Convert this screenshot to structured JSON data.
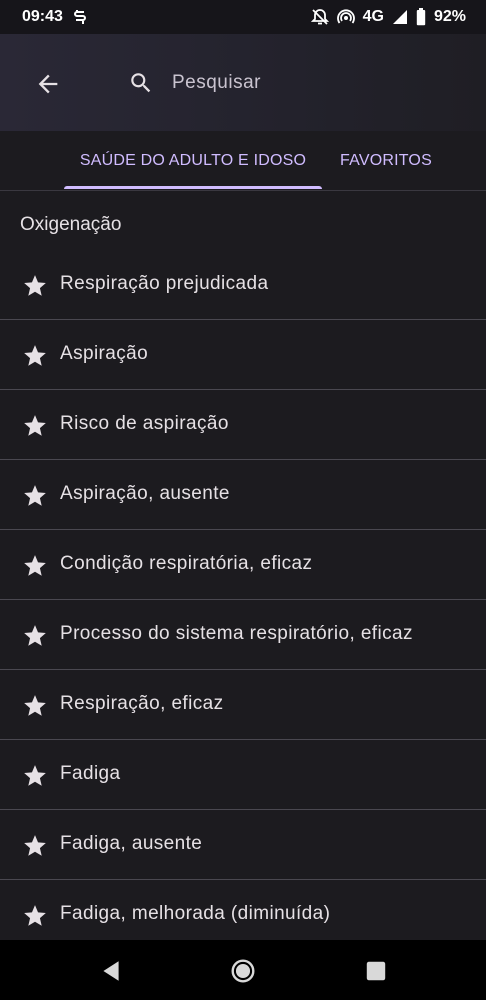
{
  "status_bar": {
    "time": "09:43",
    "network": "4G",
    "battery": "92%",
    "icons": [
      "s-app-icon",
      "bell-off-icon",
      "hotspot-icon",
      "signal-icon",
      "battery-icon"
    ]
  },
  "app_bar": {
    "back_icon": "arrow-left-icon",
    "search_icon": "search-icon",
    "search_placeholder": "Pesquisar"
  },
  "tabs": [
    {
      "label": "SAÚDE DO ADULTO E IDOSO",
      "selected": true
    },
    {
      "label": "FAVORITOS",
      "selected": false
    }
  ],
  "colors": {
    "accent": "#d0bcff",
    "background": "#1c1b1f",
    "text": "#e6e1e5"
  },
  "section": {
    "title": "Oxigenação",
    "items": [
      {
        "label": "Respiração prejudicada"
      },
      {
        "label": "Aspiração"
      },
      {
        "label": "Risco de aspiração"
      },
      {
        "label": "Aspiração, ausente"
      },
      {
        "label": "Condição respiratória, eficaz"
      },
      {
        "label": "Processo do sistema respiratório, eficaz"
      },
      {
        "label": "Respiração, eficaz"
      },
      {
        "label": "Fadiga"
      },
      {
        "label": "Fadiga, ausente"
      },
      {
        "label": "Fadiga, melhorada (diminuída)"
      }
    ]
  },
  "nav_bar": {
    "icons": [
      "back-triangle-icon",
      "home-circle-icon",
      "recents-square-icon"
    ]
  }
}
